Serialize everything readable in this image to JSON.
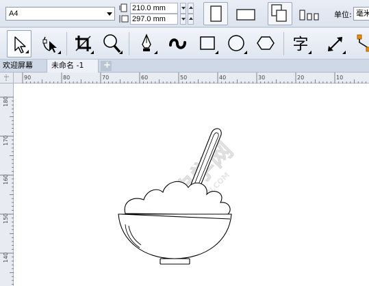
{
  "property_bar": {
    "paper_size": "A4",
    "width_value": "210.0 mm",
    "height_value": "297.0 mm",
    "units_label": "单位:",
    "units_value": "毫米"
  },
  "toolbox": {
    "tools": [
      {
        "name": "pick-tool",
        "icon": "arrow-cursor-icon"
      },
      {
        "name": "shape-tool",
        "icon": "shape-node-icon"
      },
      {
        "name": "crop-tool",
        "icon": "crop-icon"
      },
      {
        "name": "zoom-tool",
        "icon": "magnifier-icon"
      },
      {
        "name": "freehand-tool",
        "icon": "pen-nib-icon"
      },
      {
        "name": "artistic-media-tool",
        "icon": "brush-stroke-icon"
      },
      {
        "name": "rectangle-tool",
        "icon": "rectangle-icon"
      },
      {
        "name": "ellipse-tool",
        "icon": "ellipse-icon"
      },
      {
        "name": "polygon-tool",
        "icon": "hexagon-icon"
      },
      {
        "name": "text-tool",
        "icon": "text-glyph-icon",
        "glyph": "字"
      },
      {
        "name": "dimension-tool",
        "icon": "diagonal-dimension-icon"
      },
      {
        "name": "connector-tool",
        "icon": "connector-icon"
      }
    ]
  },
  "tabs": {
    "welcome": "欢迎屏幕",
    "document": "未命名 -1",
    "add": "+"
  },
  "rulers": {
    "horizontal_labels": [
      "90",
      "80",
      "70",
      "60",
      "50",
      "40",
      "30",
      "20",
      "10"
    ],
    "vertical_labels": [
      "180",
      "170",
      "160",
      "150",
      "140"
    ]
  },
  "watermark": {
    "main": "软件自学网",
    "sub": "WWW.RJZXW.COM"
  },
  "colors": {
    "toolbar_bg": "#dfe6f0",
    "canvas_bg": "#ffffff",
    "accent_orange": "#f08a00",
    "outline": "#000000"
  }
}
